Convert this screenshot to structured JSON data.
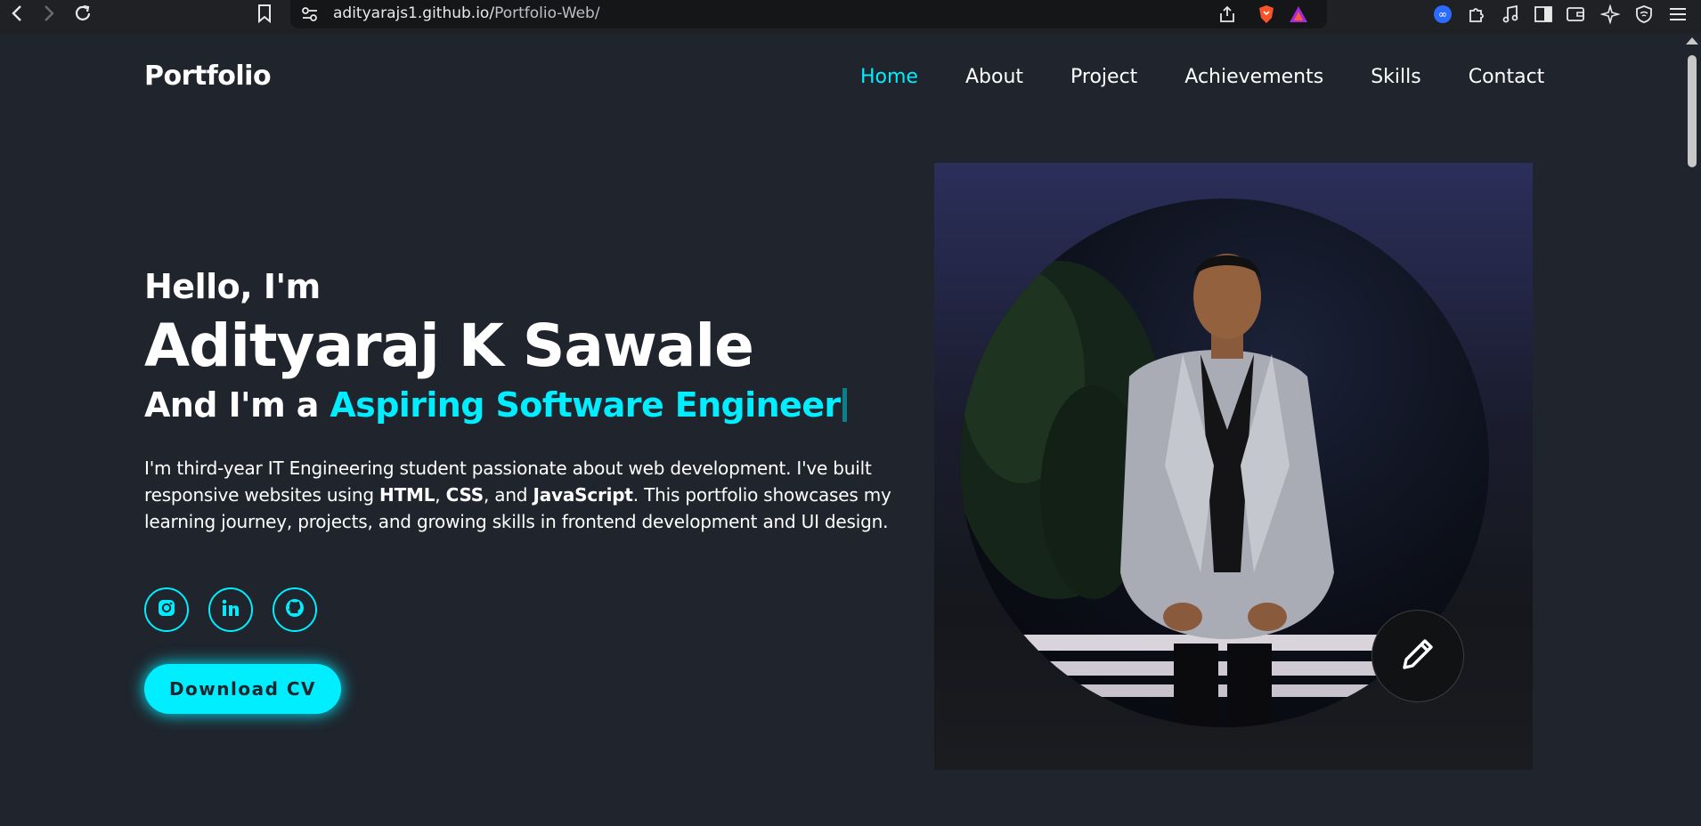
{
  "browser": {
    "url_host": "adityarajs1.github.io/",
    "url_path": "Portfolio-Web/"
  },
  "site": {
    "logo": "Portfolio",
    "nav": [
      {
        "label": "Home",
        "active": true
      },
      {
        "label": "About"
      },
      {
        "label": "Project"
      },
      {
        "label": "Achievements"
      },
      {
        "label": "Skills"
      },
      {
        "label": "Contact"
      }
    ]
  },
  "hero": {
    "greeting": "Hello, I'm",
    "name": "Adityaraj K Sawale",
    "role_prefix": "And I'm a ",
    "role_accent": "Aspiring Software Engineer",
    "bio_1": "I'm third-year IT Engineering student passionate about web development. I've built responsive websites using ",
    "bio_html": "HTML",
    "bio_sep1": ", ",
    "bio_css": "CSS",
    "bio_sep2": ", and ",
    "bio_js": "JavaScript",
    "bio_2": ". This portfolio showcases my learning journey, projects, and growing skills in frontend development and UI design.",
    "download_cv": "Download CV"
  },
  "socials": [
    "instagram-icon",
    "linkedin-icon",
    "github-icon"
  ],
  "colors": {
    "accent": "#00eeff",
    "background": "#1f242d"
  }
}
